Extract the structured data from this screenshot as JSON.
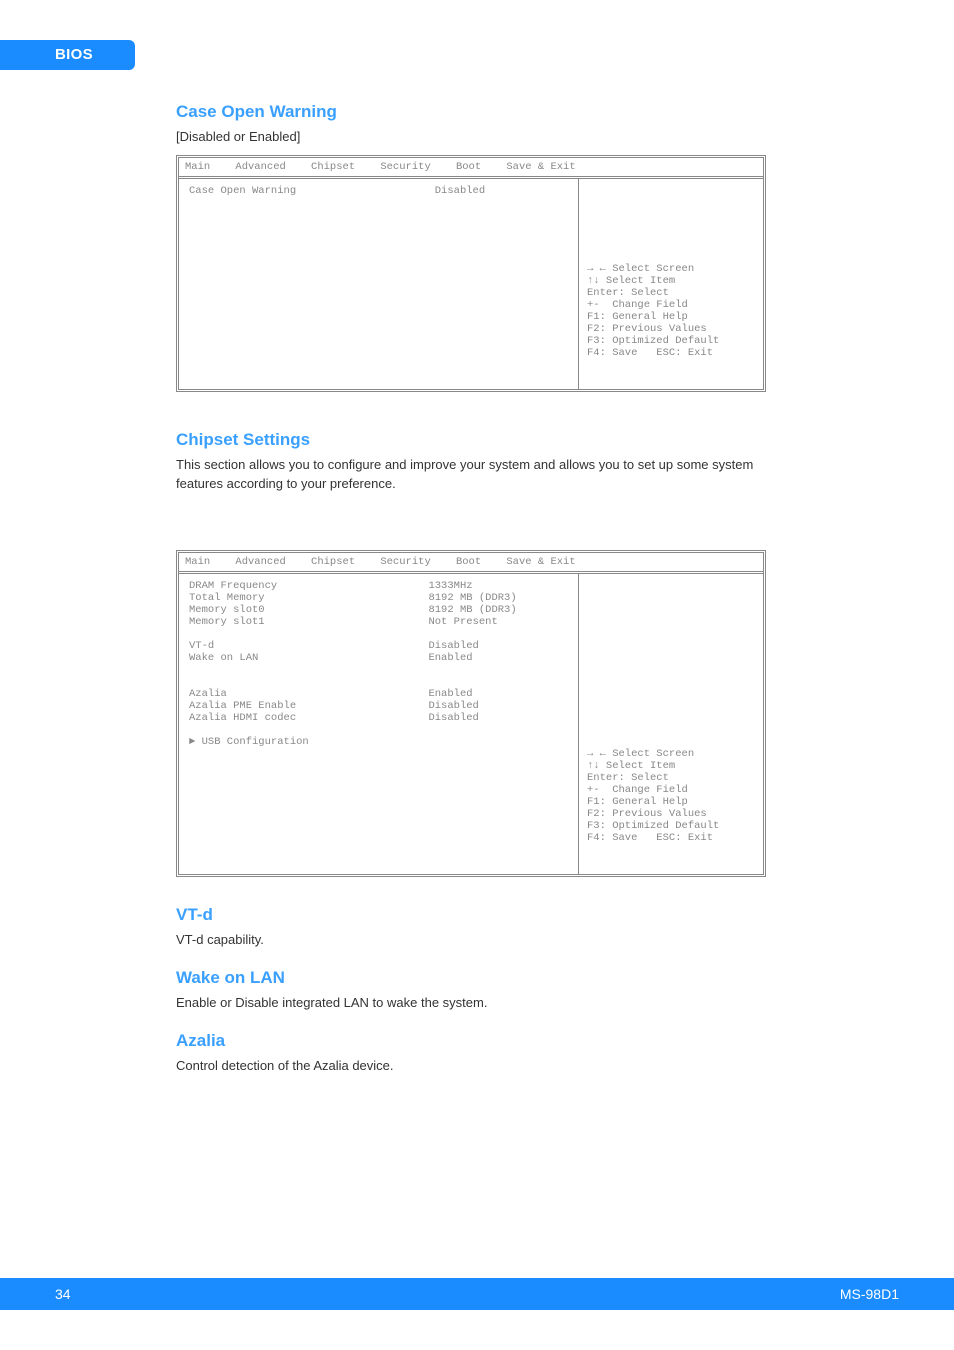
{
  "tab_label": "BIOS",
  "section1": {
    "title": "Case Open Warning",
    "desc": "[Disabled or Enabled]",
    "box": {
      "header_tabs": "Main    Advanced    Chipset    Security    Boot    Save & Exit",
      "left": "Case Open Warning                      Disabled",
      "right_top": "",
      "help": "→ ← Select Screen\n↑↓ Select Item\nEnter: Select\n+-  Change Field\nF1: General Help\nF2: Previous Values\nF3: Optimized Default\nF4: Save   ESC: Exit"
    }
  },
  "chipset": {
    "title": "Chipset Settings",
    "desc": "This section allows you to configure and improve your system and allows you to set up some system features according to your preference."
  },
  "section2": {
    "box": {
      "header_tabs": "Main    Advanced    Chipset    Security    Boot    Save & Exit",
      "left": "DRAM Frequency                        1333MHz\nTotal Memory                          8192 MB (DDR3)\nMemory slot0                          8192 MB (DDR3)\nMemory slot1                          Not Present\n\nVT-d                                  Disabled\nWake on LAN                           Enabled\n\n\nAzalia                                Enabled\nAzalia PME Enable                     Disabled\nAzalia HDMI codec                     Disabled\n\n► USB Configuration\n\n",
      "right_top": "",
      "help": "→ ← Select Screen\n↑↓ Select Item\nEnter: Select\n+-  Change Field\nF1: General Help\nF2: Previous Values\nF3: Optimized Default\nF4: Save   ESC: Exit"
    }
  },
  "vtd": {
    "title": "VT-d",
    "desc": "VT-d capability."
  },
  "wol": {
    "title": "Wake on LAN",
    "desc": "Enable or Disable integrated LAN to wake the system."
  },
  "azalia": {
    "title": "Azalia",
    "desc": "Control detection of the Azalia device."
  },
  "footer": {
    "page": "34",
    "product": "MS-98D1"
  }
}
